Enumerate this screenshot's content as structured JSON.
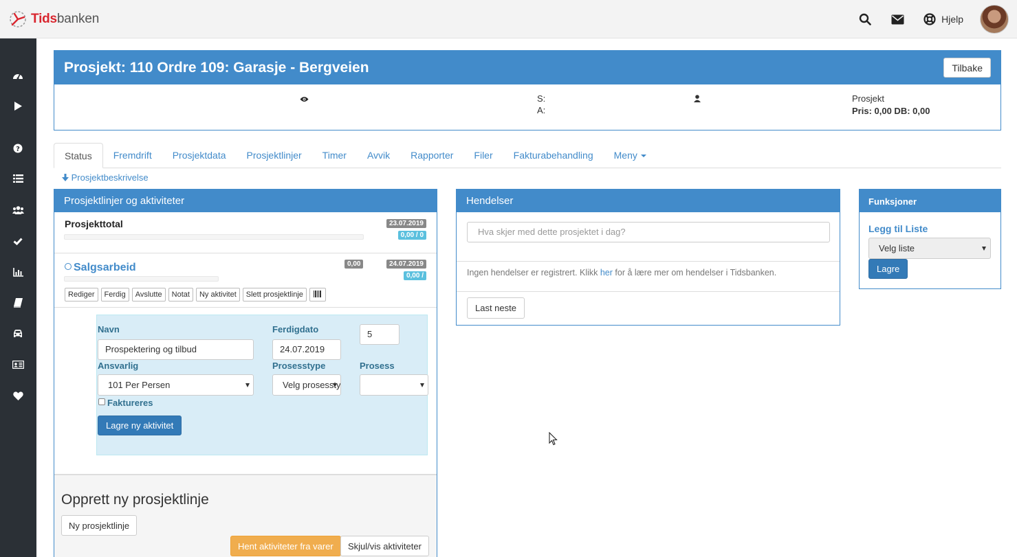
{
  "app": {
    "logo_red": "Tids",
    "logo_grey": "banken",
    "help_label": "Hjelp"
  },
  "project": {
    "title": "Prosjekt: 110 Ordre 109: Garasje - Bergveien",
    "back_label": "Tilbake",
    "s_label": "S:",
    "a_label": "A:",
    "type_label": "Prosjekt",
    "price_line": "Pris: 0,00 DB: 0,00"
  },
  "tabs": [
    {
      "label": "Status"
    },
    {
      "label": "Fremdrift"
    },
    {
      "label": "Prosjektdata"
    },
    {
      "label": "Prosjektlinjer"
    },
    {
      "label": "Timer"
    },
    {
      "label": "Avvik"
    },
    {
      "label": "Rapporter"
    },
    {
      "label": "Filer"
    },
    {
      "label": "Fakturabehandling"
    },
    {
      "label": "Meny"
    }
  ],
  "description_link": "Prosjektbeskrivelse",
  "left_panel": {
    "title": "Prosjektlinjer og aktiviteter",
    "total": {
      "name": "Prosjekttotal",
      "date": "23.07.2019",
      "value": "0,00 / 0"
    },
    "sales": {
      "name": "Salgsarbeid",
      "amount": "0,00",
      "date": "24.07.2019",
      "value": "0,00 /"
    },
    "actions": [
      "Rediger",
      "Ferdig",
      "Avslutte",
      "Notat",
      "Ny aktivitet",
      "Slett prosjektlinje"
    ],
    "form": {
      "name_label": "Navn",
      "name_value": "Prospektering og tilbud",
      "due_label": "Ferdigdato",
      "due_value": "24.07.2019",
      "number_value": "5",
      "responsible_label": "Ansvarlig",
      "responsible_value": "101 Per Persen",
      "process_type_label": "Prosesstype",
      "process_type_value": "Velg prosesstype",
      "process_label": "Prosess",
      "process_value": "",
      "invoice_label": "Faktureres",
      "save_label": "Lagre ny aktivitet"
    },
    "new_line": {
      "heading": "Opprett ny prosjektlinje",
      "new_button": "Ny prosjektlinje",
      "fetch_button": "Hent aktiviteter fra varer",
      "toggle_button": "Skjul/vis aktiviteter"
    }
  },
  "events": {
    "title": "Hendelser",
    "placeholder": "Hva skjer med dette prosjektet i dag?",
    "msg_before": "Ingen hendelser er registrert. Klikk ",
    "msg_link": "her",
    "msg_after": " for å lære mer om hendelser i Tidsbanken.",
    "next_button": "Last neste"
  },
  "functions": {
    "title": "Funksjoner",
    "add_label": "Legg til Liste",
    "select_value": "Velg liste",
    "save_label": "Lagre"
  },
  "colors": {
    "primary": "#428bca",
    "sidebar": "#2b3036",
    "warning": "#f0ad4e",
    "info_bg": "#d9edf7"
  }
}
